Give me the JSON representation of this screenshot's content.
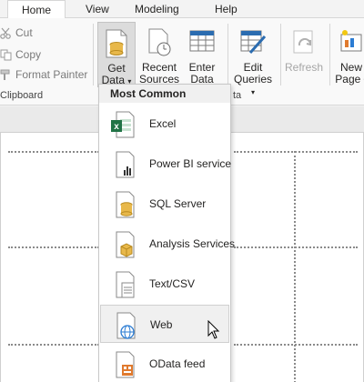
{
  "tabs": [
    {
      "label": "Home"
    },
    {
      "label": "View"
    },
    {
      "label": "Modeling"
    },
    {
      "label": "Help"
    }
  ],
  "clipboard": {
    "cut_label": "Cut",
    "copy_label": "Copy",
    "format_painter_label": "Format Painter",
    "group_label": "Clipboard"
  },
  "data_group": {
    "get_data_line1": "Get",
    "get_data_line2": "Data",
    "recent_sources_line1": "Recent",
    "recent_sources_line2": "Sources",
    "enter_data_line1": "Enter",
    "enter_data_line2": "Data",
    "group_label_partial": "ta"
  },
  "queries": {
    "edit_queries_line1": "Edit",
    "edit_queries_line2": "Queries",
    "refresh_label": "Refresh"
  },
  "insert": {
    "new_page_line1": "New",
    "new_page_line2": "Page"
  },
  "dropdown": {
    "header": "Most Common",
    "items": [
      {
        "label": "Excel",
        "icon": "excel-icon"
      },
      {
        "label": "Power BI service",
        "icon": "power-bi-service-icon"
      },
      {
        "label": "SQL Server",
        "icon": "sql-server-icon"
      },
      {
        "label": "Analysis Services",
        "icon": "analysis-services-icon"
      },
      {
        "label": "Text/CSV",
        "icon": "text-csv-icon"
      },
      {
        "label": "Web",
        "icon": "web-icon"
      },
      {
        "label": "OData feed",
        "icon": "odata-feed-icon"
      }
    ],
    "hovered_item": "Web"
  },
  "colors": {
    "accent_excel": "#217346",
    "database_gold": "#e8b84a",
    "web_blue": "#2b7cd3",
    "odata_orange": "#e07a2e"
  }
}
